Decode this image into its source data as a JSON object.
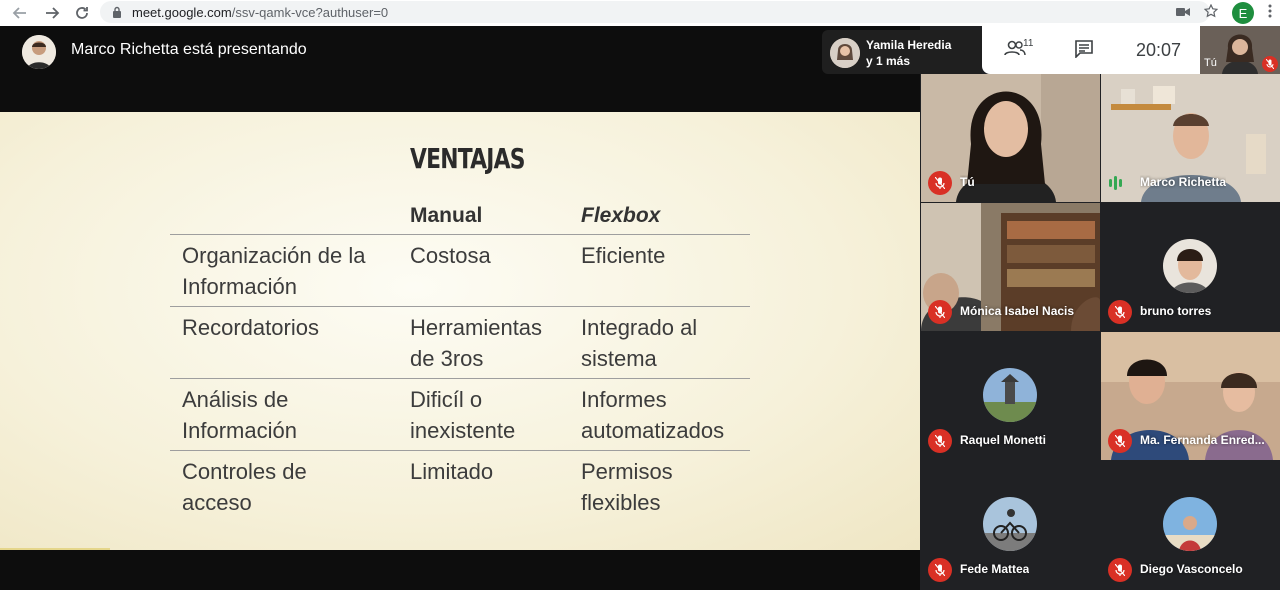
{
  "browser": {
    "url_host": "meet.google.com",
    "url_path": "/ssv-qamk-vce?authuser=0",
    "profile_initial": "E"
  },
  "presenter": {
    "text": "Marco Richetta está presentando"
  },
  "slide": {
    "title": "VENTAJAS",
    "headers": {
      "manual": "Manual",
      "flexbox": "Flexbox"
    },
    "rows": [
      {
        "label_1": "Organización de la",
        "label_2": "Información",
        "manual_1": "Costosa",
        "manual_2": "",
        "flex_1": "Eficiente",
        "flex_2": ""
      },
      {
        "label_1": "Recordatorios",
        "label_2": "",
        "manual_1": "Herramientas",
        "manual_2": "de 3ros",
        "flex_1": "Integrado al",
        "flex_2": "sistema"
      },
      {
        "label_1": "Análisis de",
        "label_2": "Información",
        "manual_1": "Dificíl o",
        "manual_2": "inexistente",
        "flex_1": "Informes",
        "flex_2": "automatizados"
      },
      {
        "label_1": "Controles de",
        "label_2": "acceso",
        "manual_1": "Limitado",
        "manual_2": "",
        "flex_1": "Permisos",
        "flex_2": "flexibles"
      }
    ]
  },
  "top": {
    "speaker_line1": "Yamila Heredia",
    "speaker_line2": "y 1 más",
    "people_count": "11",
    "clock": "20:07",
    "self_label": "Tú"
  },
  "participants": [
    {
      "name": "Tú",
      "mic": "off"
    },
    {
      "name": "Marco Richetta",
      "mic": "speaking"
    },
    {
      "name": "Mónica Isabel Nacis",
      "mic": "off"
    },
    {
      "name": "bruno torres",
      "mic": "off"
    },
    {
      "name": "Raquel Monetti",
      "mic": "off"
    },
    {
      "name": "Ma. Fernanda Enred...",
      "mic": "off"
    },
    {
      "name": "Fede Mattea",
      "mic": "off"
    },
    {
      "name": "Diego Vasconcelo",
      "mic": "off"
    }
  ],
  "colors": {
    "mic_off": "#d93025",
    "speaking": "#34a853",
    "slide_bg": "#f6f1da"
  }
}
